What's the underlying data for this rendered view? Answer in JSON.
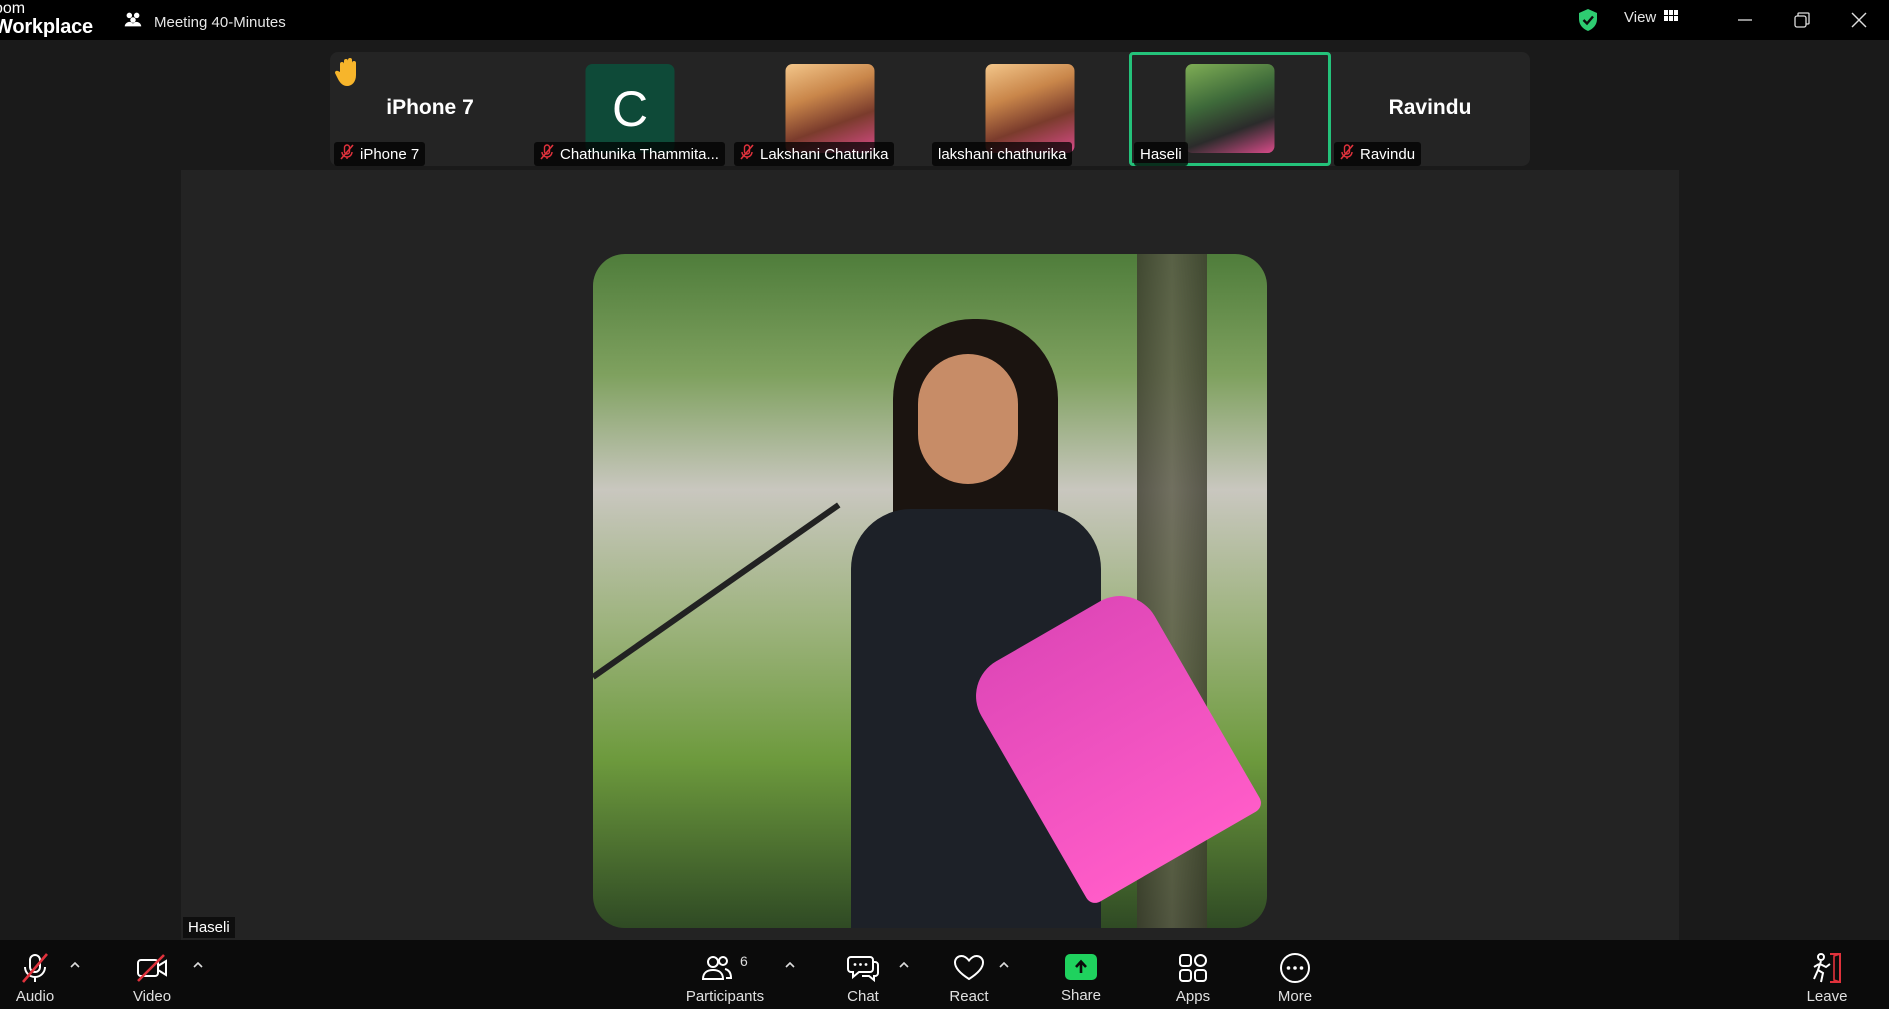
{
  "app": {
    "logo_line1": "oom",
    "logo_line2": "Workplace"
  },
  "meeting": {
    "title": "Meeting 40-Minutes",
    "icon": "meeting-people-icon"
  },
  "titlebar": {
    "view_label": "View",
    "security_icon": "shield-check-icon",
    "security_color": "#2ecc71"
  },
  "gallery": [
    {
      "big_name": "iPhone 7",
      "label": "iPhone 7",
      "muted": true,
      "hand_raised": true
    },
    {
      "initial": "C",
      "label": "Chathunika Thammita...",
      "muted": true
    },
    {
      "label": "Lakshani Chaturika",
      "muted": true
    },
    {
      "label": "lakshani chathurika",
      "muted": false
    },
    {
      "label": "Haseli",
      "muted": false,
      "active": true
    },
    {
      "big_name": "Ravindu",
      "label": "Ravindu",
      "muted": true
    }
  ],
  "stage": {
    "speaker_name": "Haseli"
  },
  "toolbar": {
    "audio": "Audio",
    "video": "Video",
    "participants": "Participants",
    "participants_count": "6",
    "chat": "Chat",
    "react": "React",
    "share": "Share",
    "apps": "Apps",
    "more": "More",
    "leave": "Leave",
    "accent": "#1fd25e",
    "danger": "#e0323c"
  }
}
